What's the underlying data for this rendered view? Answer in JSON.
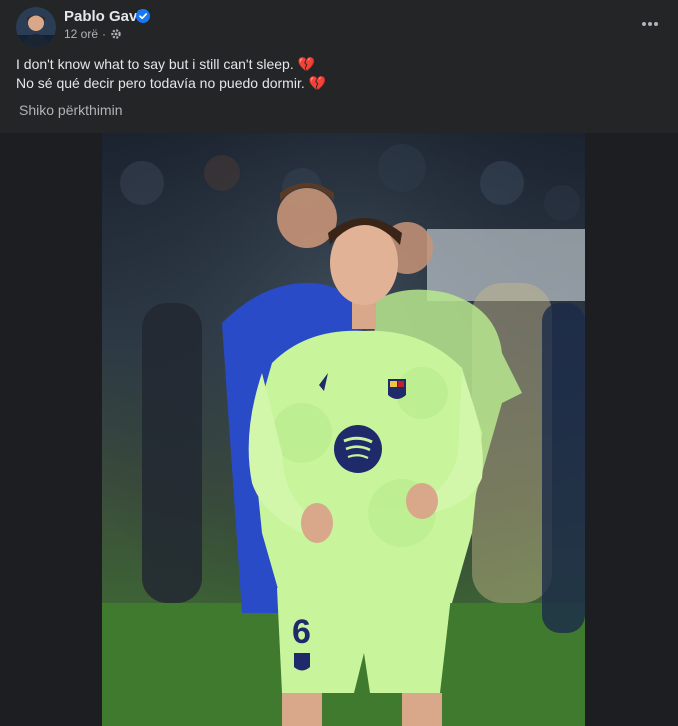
{
  "post": {
    "author_name": "Pablo Gavi",
    "verified_icon": "verified-badge-icon",
    "time": "12 orë",
    "separator": "·",
    "audience_icon": "gear-icon",
    "more_icon": "more-horizontal-icon",
    "text_line_1": "I don't know what to say but i still can't sleep.",
    "text_line_2": "No sé qué decir pero todavía no puedo dormir.",
    "emoji_1": "💔",
    "emoji_2": "💔",
    "see_translation": "Shiko përkthimin"
  },
  "photo": {
    "jersey_number": "6",
    "colors": {
      "kit_green": "#c8f59b",
      "kit_navy": "#1f2a6b",
      "opponent_blue": "#2a4bc7",
      "pitch_green": "#3f7a2e"
    }
  },
  "colors": {
    "background": "#242526",
    "text_primary": "#e4e6eb",
    "text_secondary": "#b0b3b8",
    "verified_blue": "#1877f2"
  }
}
